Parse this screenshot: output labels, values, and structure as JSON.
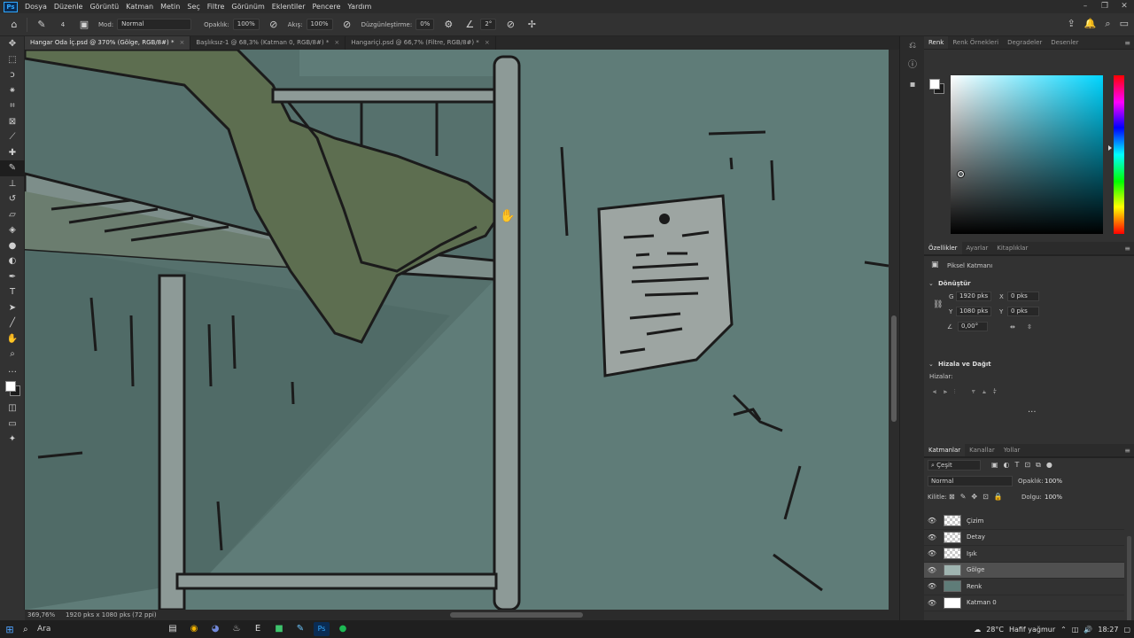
{
  "menubar": {
    "logo": "Ps",
    "items": [
      "Dosya",
      "Düzenle",
      "Görüntü",
      "Katman",
      "Metin",
      "Seç",
      "Filtre",
      "Görünüm",
      "Eklentiler",
      "Pencere",
      "Yardım"
    ]
  },
  "options": {
    "mode_label": "Mod:",
    "mode_value": "Normal",
    "opacity_label": "Opaklık:",
    "opacity_value": "100%",
    "flow_label": "Akış:",
    "flow_value": "100%",
    "smoothing_label": "Düzgünleştirme:",
    "smoothing_value": "0%",
    "angle_value": "2°",
    "brush_size": "4"
  },
  "tabs": [
    {
      "label": "Hangar Oda İç.psd @ 370% (Gölge, RGB/8#) *",
      "active": true
    },
    {
      "label": "Başlıksız-1 @ 68,3% (Katman 0, RGB/8#) *",
      "active": false
    },
    {
      "label": "Hangariçi.psd @ 66,7% (Filtre, RGB/8#) *",
      "active": false
    }
  ],
  "status": {
    "zoom": "369,76%",
    "doc_size": "1920 pks x 1080 pks (72 ppi)"
  },
  "color_panel": {
    "tabs": [
      "Renk",
      "Renk Örnekleri",
      "Degradeler",
      "Desenler"
    ],
    "foreground": "#ffffff",
    "background": "#1b1b1b",
    "hue_color": "#00d5ff"
  },
  "properties": {
    "tabs": [
      "Özellikler",
      "Ayarlar",
      "Kitaplıklar"
    ],
    "layer_type": "Piksel Katmanı",
    "transform_header": "Dönüştür",
    "w_label": "G",
    "w_value": "1920 pks",
    "h_label": "Y",
    "h_value": "1080 pks",
    "x_label": "X",
    "x_value": "0 pks",
    "y_label": "Y",
    "y_value": "0 pks",
    "angle_value": "0,00°",
    "align_header": "Hizala ve Dağıt",
    "align_sub": "Hizalar:",
    "more": "..."
  },
  "layers_panel": {
    "tabs": [
      "Katmanlar",
      "Kanallar",
      "Yollar"
    ],
    "filter_label": "Çeşit",
    "blend_mode": "Normal",
    "opacity_label": "Opaklık:",
    "opacity_value": "100%",
    "lock_label": "Kilitle:",
    "fill_label": "Dolgu:",
    "fill_value": "100%",
    "layers": [
      {
        "name": "Çizim",
        "thumb": "transparent",
        "active": false
      },
      {
        "name": "Detay",
        "thumb": "transparent",
        "active": false
      },
      {
        "name": "Işık",
        "thumb": "transparent",
        "active": false
      },
      {
        "name": "Gölge",
        "thumb": "drawing",
        "active": true
      },
      {
        "name": "Renk",
        "thumb": "color",
        "active": false
      },
      {
        "name": "Katman 0",
        "thumb": "white",
        "active": false
      }
    ]
  },
  "taskbar": {
    "search_label": "Ara",
    "weather_temp": "28°C",
    "weather_text": "Hafif yağmur",
    "time": "18:27"
  }
}
